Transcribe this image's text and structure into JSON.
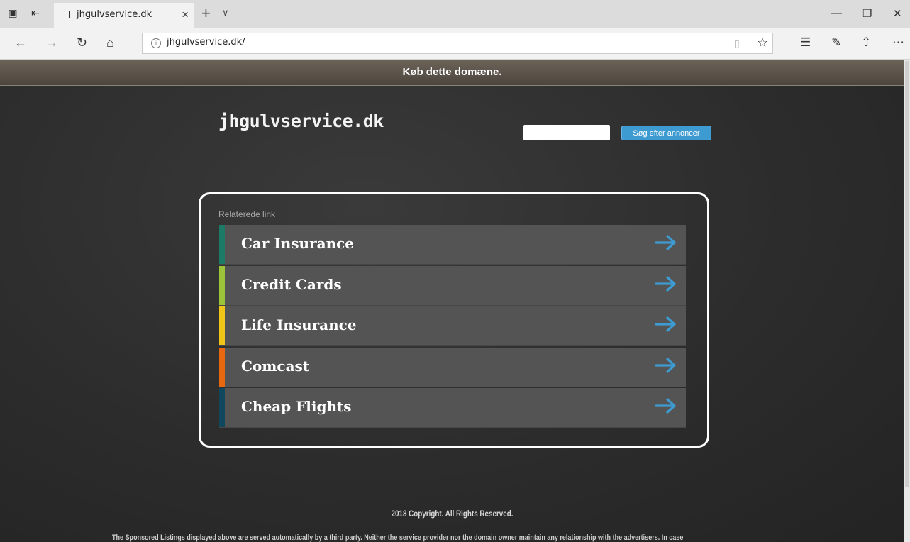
{
  "browser": {
    "tab_title": "jhgulvservice.dk",
    "url": "jhgulvservice.dk/"
  },
  "page": {
    "buy_text": "Køb dette domæne.",
    "site_title": "jhgulvservice.dk",
    "search": {
      "placeholder": "",
      "button_label": "Søg efter annoncer"
    },
    "links_heading": "Relaterede link",
    "links": [
      {
        "label": "Car Insurance",
        "color": "#1d7a66"
      },
      {
        "label": "Credit Cards",
        "color": "#9cc43a"
      },
      {
        "label": "Life Insurance",
        "color": "#f0c419"
      },
      {
        "label": "Comcast",
        "color": "#e8680f"
      },
      {
        "label": "Cheap Flights",
        "color": "#10475c"
      }
    ],
    "accent_color": "#3d9bd2",
    "copyright": "2018 Copyright. All Rights Reserved.",
    "disclaimer": "The Sponsored Listings displayed above are served automatically by a third party. Neither the service provider nor the domain owner maintain any relationship with the advertisers. In case"
  }
}
